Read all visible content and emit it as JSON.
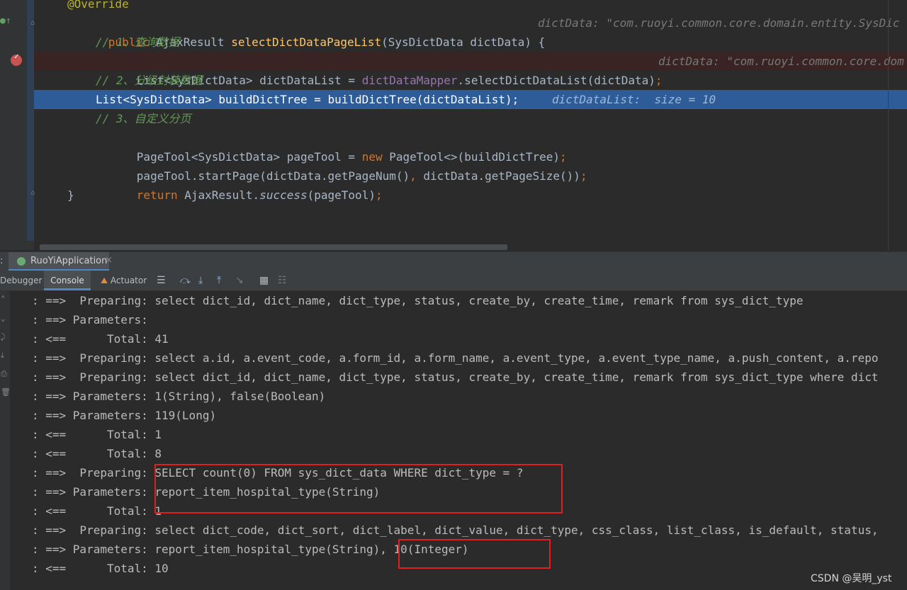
{
  "editor": {
    "line0": {
      "annotation": "@Override"
    },
    "line1": {
      "public": "public",
      "type": "AjaxResult",
      "method": "selectDictDataPageList",
      "params": "(SysDictData dictData) {",
      "hint": "dictData: \"com.ruoyi.common.core.domain.entity.SysDic"
    },
    "line2": {
      "comment": "// 1、查询数据"
    },
    "line3": {
      "decl": "List<SysDictData> dictDataList = ",
      "field": "dictDataMapper",
      "call": ".selectDictDataList(dictData)",
      "semi": ";",
      "hint": "dictData: \"com.ruoyi.common.core.dom"
    },
    "line4": {
      "comment": "// 2、分级封装数据"
    },
    "line5": {
      "code": "List<SysDictData> buildDictTree = buildDictTree(dictDataList);",
      "hint": "dictDataList:  size = 10"
    },
    "line6": {
      "comment": "// 3、自定义分页"
    },
    "line7": {
      "pre": "PageTool<SysDictData> pageTool = ",
      "kw": "new",
      "post": " PageTool<>(buildDictTree)",
      "semi": ";"
    },
    "line8": {
      "pre": "pageTool.startPage(dictData.getPageNum()",
      "comma": ",",
      "post": " dictData.getPageSize())",
      "semi": ";"
    },
    "line9": {
      "kw": "return",
      "pre": " AjaxResult.",
      "method": "success",
      "post": "(pageTool)",
      "semi": ";"
    },
    "line10": {
      "code": "}"
    }
  },
  "run_bar": {
    "colon": ":",
    "app_name": "RuoYiApplication",
    "close": "×"
  },
  "toolbar": {
    "debugger_label": "Debugger",
    "console_label": "Console",
    "actuator_label": "Actuator"
  },
  "console": {
    "lines": [
      ": ==>  Preparing: select dict_id, dict_name, dict_type, status, create_by, create_time, remark from sys_dict_type",
      ": ==> Parameters: ",
      ": <==      Total: 41",
      ": ==>  Preparing: select a.id, a.event_code, a.form_id, a.form_name, a.event_type, a.event_type_name, a.push_content, a.repo",
      ": ==>  Preparing: select dict_id, dict_name, dict_type, status, create_by, create_time, remark from sys_dict_type where dict",
      ": ==> Parameters: 1(String), false(Boolean)",
      ": ==> Parameters: 119(Long)",
      ": <==      Total: 1",
      ": <==      Total: 8",
      ": ==>  Preparing: SELECT count(0) FROM sys_dict_data WHERE dict_type = ?",
      ": ==> Parameters: report_item_hospital_type(String)",
      ": <==      Total: 1",
      ": ==>  Preparing: select dict_code, dict_sort, dict_label, dict_value, dict_type, css_class, list_class, is_default, status,",
      ": ==> Parameters: report_item_hospital_type(String), 10(Integer)",
      ": <==      Total: 10"
    ]
  },
  "watermark": "CSDN @吴明_yst",
  "colors": {
    "accent": "#4a88c7",
    "exec_line": "#2d5c98",
    "breakpoint": "#c75450",
    "highlight_box": "#e02020"
  }
}
